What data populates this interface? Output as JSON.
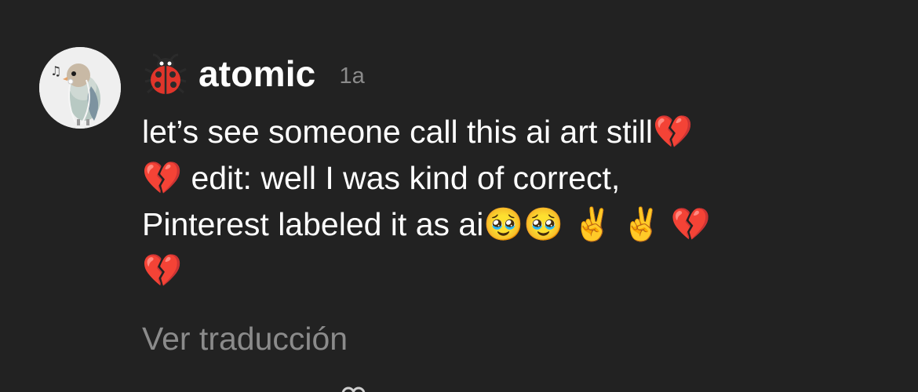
{
  "comment": {
    "avatar_icon": "bird-with-earphones-avatar",
    "badge_icon": "ladybug-emoji",
    "username": "atomic",
    "timestamp": "1a",
    "body": {
      "line1_text": "let’s see someone call this ai art still",
      "line2_text": " edit: well I was kind of correct,",
      "line3_text": "Pinterest labeled it as ai",
      "emoji_broken_heart": "💔",
      "emoji_pleading_face": "🥹",
      "emoji_victory_hand": "✌️"
    },
    "translate_label": "Ver traducción"
  },
  "colors": {
    "background": "#222222",
    "text_primary": "#ffffff",
    "text_secondary": "#8b8b8b",
    "heart": "#d7263d"
  }
}
